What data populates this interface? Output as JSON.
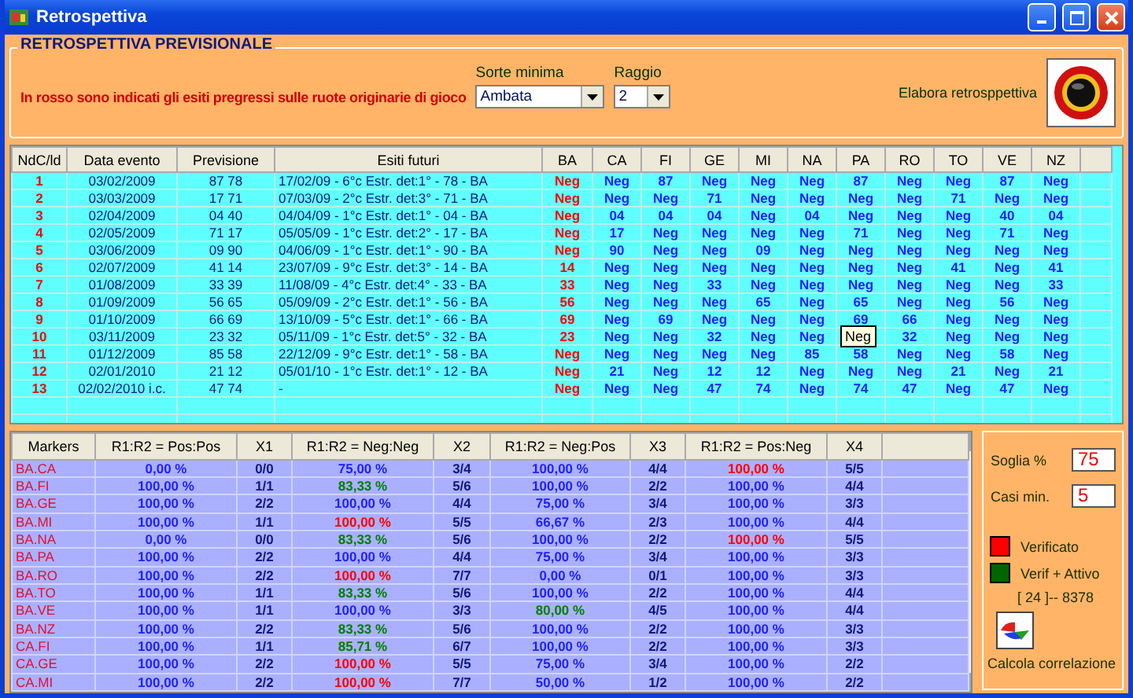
{
  "window": {
    "title": "Retrospettiva"
  },
  "group": {
    "title": "RETROSPETTIVA PREVISIONALE",
    "note": "In rosso sono indicati gli esiti pregressi sulle ruote originarie di gioco"
  },
  "sorte": {
    "label": "Sorte minima",
    "value": "Ambata"
  },
  "raggio": {
    "label": "Raggio",
    "value": "2"
  },
  "elabora": {
    "label": "Elabora retrosppettiva"
  },
  "top_table": {
    "columns": [
      {
        "label": "NdC/ld"
      },
      {
        "label": "Data evento"
      },
      {
        "label": "Previsione"
      },
      {
        "label": "Esiti futuri"
      },
      {
        "label": "BA",
        "color": "#ff0000"
      },
      {
        "label": "CA",
        "color": "#1f1fff"
      },
      {
        "label": "FI",
        "color": "#1f1fff"
      },
      {
        "label": "GE",
        "color": "#1f1fff"
      },
      {
        "label": "MI",
        "color": "#1f1fff"
      },
      {
        "label": "NA",
        "color": "#1f1fff"
      },
      {
        "label": "PA",
        "color": "#1f1fff"
      },
      {
        "label": "RO",
        "color": "#1f1fff"
      },
      {
        "label": "TO",
        "color": "#1f1fff"
      },
      {
        "label": "VE",
        "color": "#1f1fff"
      },
      {
        "label": "NZ",
        "color": "#1f1fff"
      }
    ],
    "rows": [
      [
        "1",
        "03/02/2009",
        "87 78",
        "17/02/09 - 6°c Estr. det:1° - 78 - BA",
        "Neg",
        "Neg",
        "87",
        "Neg",
        "Neg",
        "Neg",
        "87",
        "Neg",
        "Neg",
        "87",
        "Neg"
      ],
      [
        "2",
        "03/03/2009",
        "17 71",
        "07/03/09 - 2°c Estr. det:3° - 71 - BA",
        "Neg",
        "Neg",
        "Neg",
        "71",
        "Neg",
        "Neg",
        "Neg",
        "Neg",
        "71",
        "Neg",
        "Neg"
      ],
      [
        "3",
        "02/04/2009",
        "04 40",
        "04/04/09 - 1°c Estr. det:1° - 04 - BA",
        "Neg",
        "04",
        "04",
        "04",
        "Neg",
        "04",
        "Neg",
        "Neg",
        "Neg",
        "40",
        "04"
      ],
      [
        "4",
        "02/05/2009",
        "71 17",
        "05/05/09 - 1°c Estr. det:2° - 17 - BA",
        "Neg",
        "17",
        "Neg",
        "Neg",
        "Neg",
        "Neg",
        "71",
        "Neg",
        "Neg",
        "71",
        "Neg"
      ],
      [
        "5",
        "03/06/2009",
        "09 90",
        "04/06/09 - 1°c Estr. det:1° - 90 - BA",
        "Neg",
        "90",
        "Neg",
        "Neg",
        "09",
        "Neg",
        "Neg",
        "Neg",
        "Neg",
        "Neg",
        "Neg"
      ],
      [
        "6",
        "02/07/2009",
        "41 14",
        "23/07/09 - 9°c Estr. det:3° - 14 - BA",
        "14",
        "Neg",
        "Neg",
        "Neg",
        "Neg",
        "Neg",
        "Neg",
        "Neg",
        "41",
        "Neg",
        "41"
      ],
      [
        "7",
        "01/08/2009",
        "33 39",
        "11/08/09 - 4°c Estr. det:4° - 33 - BA",
        "33",
        "Neg",
        "Neg",
        "33",
        "Neg",
        "Neg",
        "Neg",
        "Neg",
        "Neg",
        "Neg",
        "33"
      ],
      [
        "8",
        "01/09/2009",
        "56 65",
        "05/09/09 - 2°c Estr. det:1° - 56 - BA",
        "56",
        "Neg",
        "Neg",
        "Neg",
        "65",
        "Neg",
        "65",
        "Neg",
        "Neg",
        "56",
        "Neg"
      ],
      [
        "9",
        "01/10/2009",
        "66 69",
        "13/10/09 - 5°c Estr. det:1° - 66 - BA",
        "69",
        "Neg",
        "69",
        "Neg",
        "Neg",
        "Neg",
        "69",
        "66",
        "Neg",
        "Neg",
        "Neg"
      ],
      [
        "10",
        "03/11/2009",
        "23 32",
        "05/11/09 - 1°c Estr. det:5° - 32 - BA",
        "23",
        "Neg",
        "Neg",
        "32",
        "Neg",
        "Neg",
        "",
        "32",
        "Neg",
        "Neg",
        "Neg"
      ],
      [
        "11",
        "01/12/2009",
        "85 58",
        "22/12/09 - 9°c Estr. det:1° - 58 - BA",
        "Neg",
        "Neg",
        "Neg",
        "Neg",
        "Neg",
        "85",
        "58",
        "Neg",
        "Neg",
        "58",
        "Neg"
      ],
      [
        "12",
        "02/01/2010",
        "21 12",
        "05/01/10 - 1°c Estr. det:1° - 12 - BA",
        "Neg",
        "21",
        "Neg",
        "12",
        "12",
        "Neg",
        "Neg",
        "Neg",
        "21",
        "Neg",
        "21"
      ],
      [
        "13",
        "02/02/2010 i.c.",
        "47 74",
        "-",
        "Neg",
        "Neg",
        "Neg",
        "47",
        "74",
        "Neg",
        "74",
        "47",
        "Neg",
        "47",
        "Neg"
      ]
    ],
    "tooltip": "Neg"
  },
  "bottom_table": {
    "columns": [
      "Markers",
      "R1:R2 = Pos:Pos",
      "X1",
      "R1:R2 = Neg:Neg",
      "X2",
      "R1:R2 = Neg:Pos",
      "X3",
      "R1:R2 = Pos:Neg",
      "X4"
    ],
    "rows": [
      {
        "cells": [
          {
            "text": "BA.CA"
          },
          {
            "text": "0,00 %",
            "color": "#1f1fff"
          },
          {
            "text": "0/0"
          },
          {
            "text": "75,00 %",
            "color": "#1f1fff"
          },
          {
            "text": "3/4"
          },
          {
            "text": "100,00 %",
            "color": "#1f1fff"
          },
          {
            "text": "4/4"
          },
          {
            "text": "100,00 %",
            "color": "#ff0000"
          },
          {
            "text": "5/5"
          }
        ]
      },
      {
        "cells": [
          {
            "text": "BA.FI"
          },
          {
            "text": "100,00 %",
            "color": "#1f1fff"
          },
          {
            "text": "1/1"
          },
          {
            "text": "83,33 %",
            "color": "#008000"
          },
          {
            "text": "5/6"
          },
          {
            "text": "100,00 %",
            "color": "#1f1fff"
          },
          {
            "text": "2/2"
          },
          {
            "text": "100,00 %",
            "color": "#1f1fff"
          },
          {
            "text": "4/4"
          }
        ]
      },
      {
        "cells": [
          {
            "text": "BA.GE"
          },
          {
            "text": "100,00 %",
            "color": "#1f1fff"
          },
          {
            "text": "2/2"
          },
          {
            "text": "100,00 %",
            "color": "#1f1fff"
          },
          {
            "text": "4/4"
          },
          {
            "text": "75,00 %",
            "color": "#1f1fff"
          },
          {
            "text": "3/4"
          },
          {
            "text": "100,00 %",
            "color": "#1f1fff"
          },
          {
            "text": "3/3"
          }
        ]
      },
      {
        "cells": [
          {
            "text": "BA.MI"
          },
          {
            "text": "100,00 %",
            "color": "#1f1fff"
          },
          {
            "text": "1/1"
          },
          {
            "text": "100,00 %",
            "color": "#ff0000"
          },
          {
            "text": "5/5"
          },
          {
            "text": "66,67 %",
            "color": "#1f1fff"
          },
          {
            "text": "2/3"
          },
          {
            "text": "100,00 %",
            "color": "#1f1fff"
          },
          {
            "text": "4/4"
          }
        ]
      },
      {
        "cells": [
          {
            "text": "BA.NA"
          },
          {
            "text": "0,00 %",
            "color": "#1f1fff"
          },
          {
            "text": "0/0"
          },
          {
            "text": "83,33 %",
            "color": "#008000"
          },
          {
            "text": "5/6"
          },
          {
            "text": "100,00 %",
            "color": "#1f1fff"
          },
          {
            "text": "2/2"
          },
          {
            "text": "100,00 %",
            "color": "#ff0000"
          },
          {
            "text": "5/5"
          }
        ]
      },
      {
        "cells": [
          {
            "text": "BA.PA"
          },
          {
            "text": "100,00 %",
            "color": "#1f1fff"
          },
          {
            "text": "2/2"
          },
          {
            "text": "100,00 %",
            "color": "#1f1fff"
          },
          {
            "text": "4/4"
          },
          {
            "text": "75,00 %",
            "color": "#1f1fff"
          },
          {
            "text": "3/4"
          },
          {
            "text": "100,00 %",
            "color": "#1f1fff"
          },
          {
            "text": "3/3"
          }
        ]
      },
      {
        "cells": [
          {
            "text": "BA.RO"
          },
          {
            "text": "100,00 %",
            "color": "#1f1fff"
          },
          {
            "text": "2/2"
          },
          {
            "text": "100,00 %",
            "color": "#ff0000"
          },
          {
            "text": "7/7"
          },
          {
            "text": "0,00 %",
            "color": "#1f1fff"
          },
          {
            "text": "0/1"
          },
          {
            "text": "100,00 %",
            "color": "#1f1fff"
          },
          {
            "text": "3/3"
          }
        ]
      },
      {
        "cells": [
          {
            "text": "BA.TO"
          },
          {
            "text": "100,00 %",
            "color": "#1f1fff"
          },
          {
            "text": "1/1"
          },
          {
            "text": "83,33 %",
            "color": "#008000"
          },
          {
            "text": "5/6"
          },
          {
            "text": "100,00 %",
            "color": "#1f1fff"
          },
          {
            "text": "2/2"
          },
          {
            "text": "100,00 %",
            "color": "#1f1fff"
          },
          {
            "text": "4/4"
          }
        ]
      },
      {
        "cells": [
          {
            "text": "BA.VE"
          },
          {
            "text": "100,00 %",
            "color": "#1f1fff"
          },
          {
            "text": "1/1"
          },
          {
            "text": "100,00 %",
            "color": "#1f1fff"
          },
          {
            "text": "3/3"
          },
          {
            "text": "80,00 %",
            "color": "#008000"
          },
          {
            "text": "4/5"
          },
          {
            "text": "100,00 %",
            "color": "#1f1fff"
          },
          {
            "text": "4/4"
          }
        ]
      },
      {
        "cells": [
          {
            "text": "BA.NZ"
          },
          {
            "text": "100,00 %",
            "color": "#1f1fff"
          },
          {
            "text": "2/2"
          },
          {
            "text": "83,33 %",
            "color": "#008000"
          },
          {
            "text": "5/6"
          },
          {
            "text": "100,00 %",
            "color": "#1f1fff"
          },
          {
            "text": "2/2"
          },
          {
            "text": "100,00 %",
            "color": "#1f1fff"
          },
          {
            "text": "3/3"
          }
        ]
      },
      {
        "cells": [
          {
            "text": "CA.FI"
          },
          {
            "text": "100,00 %",
            "color": "#1f1fff"
          },
          {
            "text": "1/1"
          },
          {
            "text": "85,71 %",
            "color": "#008000"
          },
          {
            "text": "6/7"
          },
          {
            "text": "100,00 %",
            "color": "#1f1fff"
          },
          {
            "text": "2/2"
          },
          {
            "text": "100,00 %",
            "color": "#1f1fff"
          },
          {
            "text": "3/3"
          }
        ]
      },
      {
        "cells": [
          {
            "text": "CA.GE"
          },
          {
            "text": "100,00 %",
            "color": "#1f1fff"
          },
          {
            "text": "2/2"
          },
          {
            "text": "100,00 %",
            "color": "#ff0000"
          },
          {
            "text": "5/5"
          },
          {
            "text": "75,00 %",
            "color": "#1f1fff"
          },
          {
            "text": "3/4"
          },
          {
            "text": "100,00 %",
            "color": "#1f1fff"
          },
          {
            "text": "2/2"
          }
        ]
      },
      {
        "cells": [
          {
            "text": "CA.MI"
          },
          {
            "text": "100,00 %",
            "color": "#1f1fff"
          },
          {
            "text": "2/2"
          },
          {
            "text": "100,00 %",
            "color": "#ff0000"
          },
          {
            "text": "7/7"
          },
          {
            "text": "50,00 %",
            "color": "#1f1fff"
          },
          {
            "text": "1/2"
          },
          {
            "text": "100,00 %",
            "color": "#1f1fff"
          },
          {
            "text": "2/2"
          }
        ]
      }
    ]
  },
  "side": {
    "soglia_label": "Soglia %",
    "soglia_value": "75",
    "casi_label": "Casi min.",
    "casi_value": "5",
    "legend": [
      {
        "label": "Verificato",
        "color": "#ff0000"
      },
      {
        "label": "Verif + Attivo",
        "color": "#006400"
      }
    ],
    "count": "[ 24 ]-- 8378",
    "calcola": "Calcola correlazione"
  }
}
